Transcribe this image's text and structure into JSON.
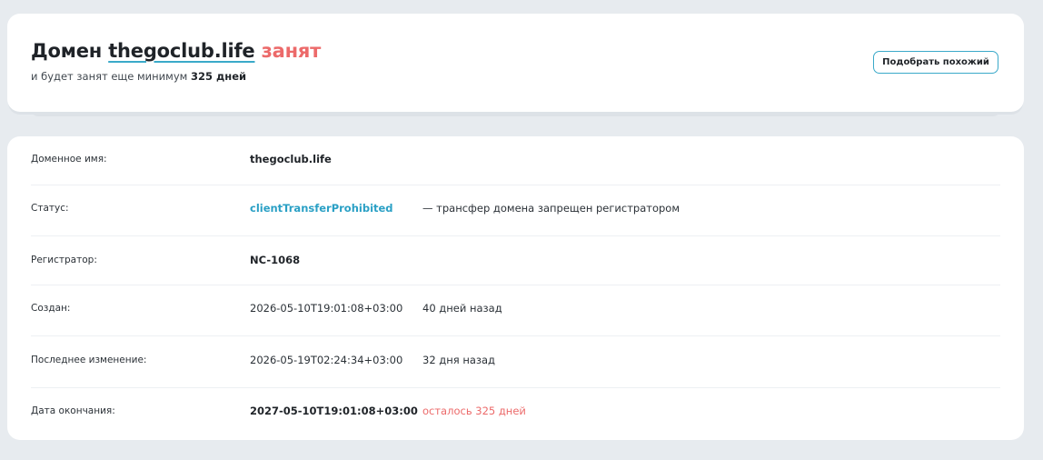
{
  "header": {
    "prefix": "Домен",
    "domain": "thegoclub.life",
    "status_word": "занят",
    "sub_prefix": "и будет занят еще минимум",
    "sub_days": "325 дней",
    "similar_button": "Подобрать похожий"
  },
  "details": {
    "domain_name": {
      "label": "Доменное имя:",
      "value": "thegoclub.life"
    },
    "status": {
      "label": "Статус:",
      "value": "clientTransferProhibited",
      "note": "— трансфер домена запрещен регистратором"
    },
    "registrar": {
      "label": "Регистратор:",
      "value": "NC-1068"
    },
    "created": {
      "label": "Создан:",
      "value": "2026-05-10T19:01:08+03:00",
      "note": "40 дней назад"
    },
    "updated": {
      "label": "Последнее изменение:",
      "value": "2026-05-19T02:24:34+03:00",
      "note": "32 дня назад"
    },
    "expires": {
      "label": "Дата окончания:",
      "value": "2027-05-10T19:01:08+03:00",
      "note": "осталось 325 дней"
    }
  },
  "colors": {
    "accent": "#3aa9c9",
    "taken": "#ec6a6a",
    "background": "#e7ebef"
  }
}
